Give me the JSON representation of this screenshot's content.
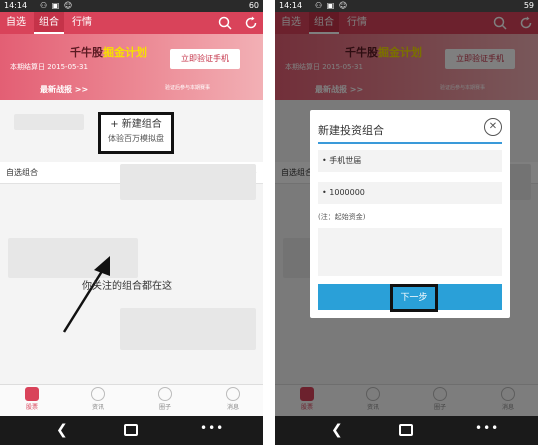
{
  "left_phone": {
    "status": {
      "time": "14:14",
      "icons": "⚇ ▣ ☺",
      "battery": "60"
    },
    "tabs": [
      "自选",
      "组合",
      "行情"
    ],
    "banner": {
      "title_part1": "千牛股",
      "title_part2": "掘金计划",
      "date": "本期结算日 2015-05-31",
      "cta": "立即验证手机",
      "notice": "验证后参与本期赛事",
      "strategy": "最新战报 >>"
    },
    "new_portfolio": {
      "line1": "+ 新建组合",
      "line2": "体验百万模拟盘"
    },
    "section_label": "自选组合",
    "section_chev": ">",
    "empty_text": "你关注的组合都在这",
    "bottom_tabs": [
      "股票",
      "资讯",
      "圈子",
      "消息"
    ]
  },
  "right_phone": {
    "status": {
      "time": "14:14",
      "icons": "⚇ ▣ ☺",
      "battery": "59"
    },
    "tabs": [
      "自选",
      "组合",
      "行情"
    ],
    "banner": {
      "title_part1": "千牛股",
      "title_part2": "掘金计划",
      "date": "本期结算日 2015-05-31",
      "cta": "立即验证手机",
      "notice": "验证后参与本期赛事",
      "strategy": "最新战报 >>"
    },
    "section_label": "自选组合",
    "dialog": {
      "title": "新建投资组合",
      "close": "✕",
      "field_name": "• 手机世届",
      "field_amount": "• 1000000",
      "note": "(注：起始资金)",
      "next_button": "下一步"
    },
    "bottom_tabs": [
      "股票",
      "资讯",
      "圈子",
      "消息"
    ]
  },
  "navbar": {
    "back": "❮",
    "menu": "•••"
  },
  "colors": {
    "brand_red": "#d9435a",
    "dialog_blue": "#2aa0d8",
    "highlight_yellow": "#f7e000"
  }
}
